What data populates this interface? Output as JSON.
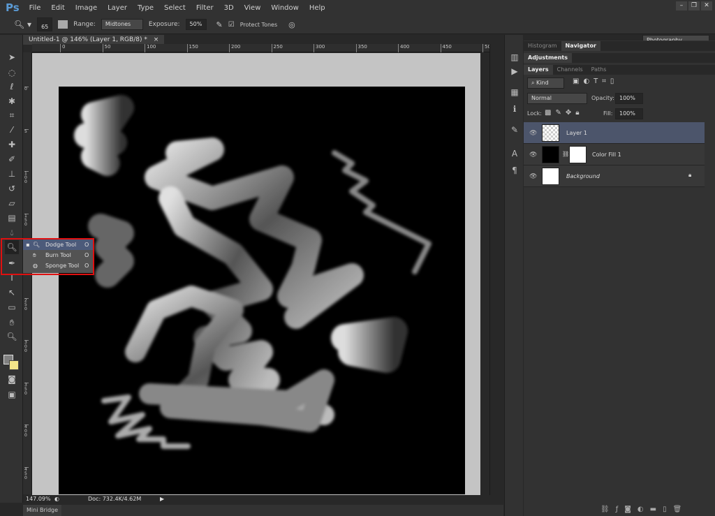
{
  "app": {
    "logo": "Ps",
    "menus": [
      "File",
      "Edit",
      "Image",
      "Layer",
      "Type",
      "Select",
      "Filter",
      "3D",
      "View",
      "Window",
      "Help"
    ]
  },
  "options": {
    "brush_size": "65",
    "range_label": "Range:",
    "range_value": "Midtones",
    "exposure_label": "Exposure:",
    "exposure_value": "50%",
    "protect_tones_label": "Protect Tones",
    "protect_tones_checked": true,
    "workspace": "Photography"
  },
  "document": {
    "tab_title": "Untitled-1 @ 146% (Layer 1, RGB/8) *",
    "close": "×",
    "hruler": [
      "0",
      "50",
      "100",
      "150",
      "200",
      "250",
      "300",
      "350",
      "400",
      "450",
      "500"
    ],
    "vruler": [
      "0",
      "5",
      "1 0 0",
      "1 5 0",
      "2 0 0",
      "2 5 0",
      "3 0 0",
      "3 5 0",
      "4 0 0",
      "4 5 0"
    ]
  },
  "flyout": {
    "items": [
      {
        "label": "Dodge Tool",
        "key": "O",
        "selected": true
      },
      {
        "label": "Burn Tool",
        "key": "O"
      },
      {
        "label": "Sponge Tool",
        "key": "O"
      }
    ]
  },
  "status": {
    "zoom": "147.09%",
    "doc": "Doc: 732.4K/4.62M"
  },
  "minibridge": {
    "label": "Mini Bridge"
  },
  "panels": {
    "top_tabs": [
      "Histogram",
      "Navigator"
    ],
    "adjustments": "Adjustments",
    "layer_tabs": [
      "Layers",
      "Channels",
      "Paths"
    ],
    "filter_kind": "Kind",
    "blend_mode": "Normal",
    "opacity_label": "Opacity:",
    "opacity": "100%",
    "lock_label": "Lock:",
    "fill_label": "Fill:",
    "fill": "100%",
    "layers": [
      {
        "name": "Layer 1",
        "selected": true
      },
      {
        "name": "Color Fill 1"
      },
      {
        "name": "Background",
        "locked": true
      }
    ]
  },
  "colors": {
    "selection_highlight": "#4c556b",
    "annotation_box": "#e01010",
    "foreground": "#808080",
    "background": "#f3e58a"
  }
}
